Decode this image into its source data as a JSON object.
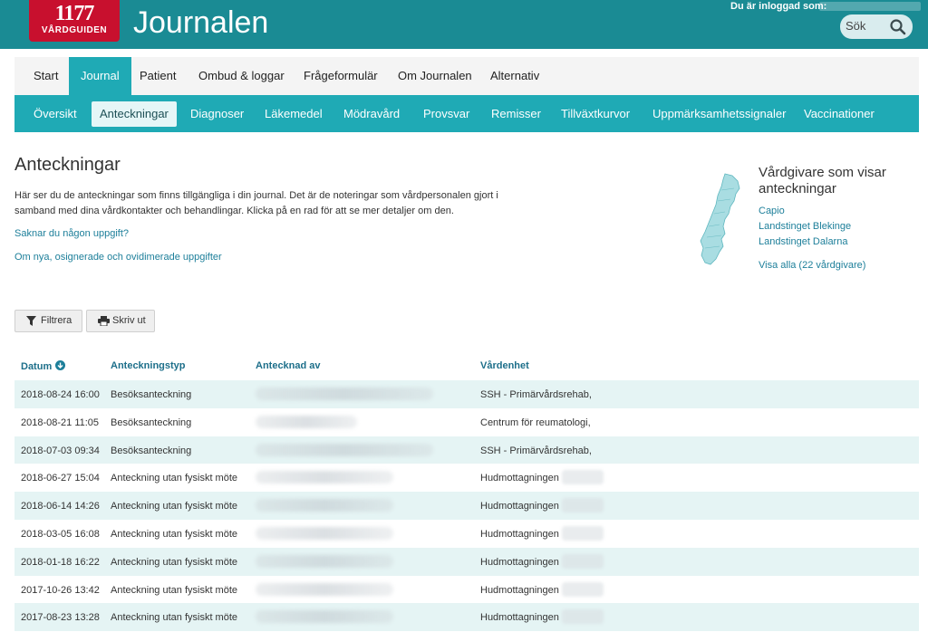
{
  "header": {
    "logo_number": "1177",
    "logo_text": "VÅRDGUIDEN",
    "app_title": "Journalen",
    "login_label": "Du är inloggad som:",
    "search_placeholder": "Sök",
    "colors": {
      "header_bg": "#1a8b94",
      "logo_bg": "#c8102e",
      "accent": "#1faab5"
    }
  },
  "main_nav": [
    {
      "label": "Start"
    },
    {
      "label": "Journal",
      "active": true
    },
    {
      "label": "Patient"
    },
    {
      "label": "Ombud & loggar"
    },
    {
      "label": "Frågeformulär"
    },
    {
      "label": "Om Journalen"
    },
    {
      "label": "Alternativ"
    }
  ],
  "sub_nav": [
    {
      "label": "Översikt"
    },
    {
      "label": "Anteckningar",
      "active": true
    },
    {
      "label": "Diagnoser"
    },
    {
      "label": "Läkemedel"
    },
    {
      "label": "Mödravård"
    },
    {
      "label": "Provsvar"
    },
    {
      "label": "Remisser"
    },
    {
      "label": "Tillväxtkurvor"
    },
    {
      "label": "Uppmärksamhetssignaler"
    },
    {
      "label": "Vaccinationer"
    }
  ],
  "page": {
    "title": "Anteckningar",
    "intro_line1": "Här ser du de anteckningar som finns tillgängliga i din journal. Det är de noteringar som vårdpersonalen gjort i",
    "intro_line2": "samband med dina vårdkontakter och behandlingar. Klicka på en rad för att se mer detaljer om den.",
    "link_missing": "Saknar du någon uppgift?",
    "link_new": "Om nya, osignerade och ovidimerade uppgifter"
  },
  "sidebar": {
    "title": "Vårdgivare som visar anteckningar",
    "providers": [
      "Capio",
      "Landstinget Blekinge",
      "Landstinget Dalarna"
    ],
    "show_all": "Visa alla (22 vårdgivare)"
  },
  "toolbar": {
    "filter_label": "Filtrera",
    "print_label": "Skriv ut"
  },
  "table": {
    "headers": {
      "date": "Datum",
      "type": "Anteckningstyp",
      "author": "Antecknad av",
      "unit": "Vårdenhet"
    },
    "rows": [
      {
        "date": "2018-08-24 16:00",
        "type": "Besöksanteckning",
        "unit": "SSH - Primärvårdsrehab,"
      },
      {
        "date": "2018-08-21 11:05",
        "type": "Besöksanteckning",
        "unit": "Centrum för reumatologi,"
      },
      {
        "date": "2018-07-03 09:34",
        "type": "Besöksanteckning",
        "unit": "SSH - Primärvårdsrehab,"
      },
      {
        "date": "2018-06-27 15:04",
        "type": "Anteckning utan fysiskt möte",
        "unit": "Hudmottagningen"
      },
      {
        "date": "2018-06-14 14:26",
        "type": "Anteckning utan fysiskt möte",
        "unit": "Hudmottagningen"
      },
      {
        "date": "2018-03-05 16:08",
        "type": "Anteckning utan fysiskt möte",
        "unit": "Hudmottagningen"
      },
      {
        "date": "2018-01-18 16:22",
        "type": "Anteckning utan fysiskt möte",
        "unit": "Hudmottagningen"
      },
      {
        "date": "2017-10-26 13:42",
        "type": "Anteckning utan fysiskt möte",
        "unit": "Hudmottagningen"
      },
      {
        "date": "2017-08-23 13:28",
        "type": "Anteckning utan fysiskt möte",
        "unit": "Hudmottagningen"
      }
    ]
  }
}
